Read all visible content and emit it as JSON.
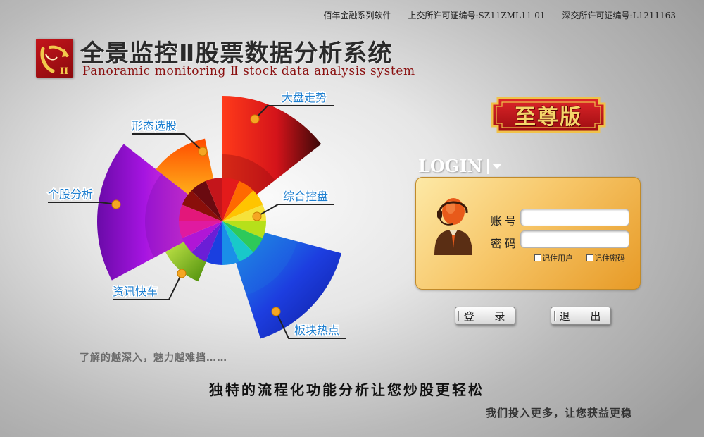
{
  "header": {
    "vendor": "佰年金融系列软件",
    "sh_license": "上交所许可证编号:SZ11ZML11-01",
    "sz_license": "深交所许可证编号:L1211163"
  },
  "brand": {
    "logo_mark": "II",
    "title_cn": "全景监控Ⅱ股票数据分析系统",
    "title_en": "Panoramic monitoring Ⅱ stock data analysis system",
    "edition": "至尊版",
    "colors": {
      "logo_red": "#c4151b",
      "edition_gold": "#f5d66a",
      "title_en": "#8a1010"
    }
  },
  "chart_data": {
    "type": "radial-menu",
    "items": [
      {
        "label": "大盘走势",
        "color": "#e31b1b"
      },
      {
        "label": "综合控盘",
        "color": "#9b1bd6"
      },
      {
        "label": "板块热点",
        "color": "#1a3fe0"
      },
      {
        "label": "资讯快车",
        "color": "#8cc61e"
      },
      {
        "label": "个股分析",
        "color": "#a514e0"
      },
      {
        "label": "形态选股",
        "color": "#ff6a00"
      }
    ]
  },
  "login": {
    "label": "LOGIN",
    "account_label": "账号",
    "password_label": "密码",
    "account_value": "",
    "password_value": "",
    "remember_user": "记住用户",
    "remember_password": "记住密码",
    "login_button": "登 录",
    "exit_button": "退 出"
  },
  "taglines": {
    "line1": "了解的越深入，魅力越难挡……",
    "line2": "独特的流程化功能分析让您炒股更轻松",
    "line3": "我们投入更多，让您获益更稳"
  }
}
